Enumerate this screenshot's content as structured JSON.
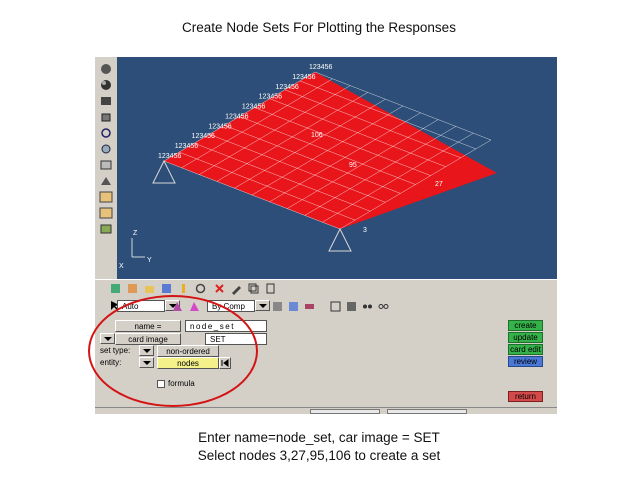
{
  "slide": {
    "title": "Create Node Sets For Plotting the Responses",
    "caption_line1": "Enter name=node_set, car image = SET",
    "caption_line2": "Select nodes 3,27,95,106 to create a set"
  },
  "viewport": {
    "background": "#2d4e78",
    "mesh_color": "#e8151b",
    "node_labels": [
      "123456",
      "123456",
      "123456",
      "123456",
      "123456",
      "123456",
      "123456",
      "123456",
      "123456",
      "123456"
    ],
    "node_ids": [
      "106",
      "95",
      "27",
      "3"
    ],
    "axes": {
      "z": "Z",
      "x": "X",
      "y": "Y"
    }
  },
  "optbar": {
    "auto_label": "Auto",
    "comp_label": "By Comp"
  },
  "panel": {
    "name_label": "name =",
    "name_value": "node_set",
    "card_image_label": "card image",
    "card_image_value": "SET",
    "set_type_label": "set type:",
    "set_type_value": "non-ordered",
    "entity_label": "entity:",
    "entity_value": "nodes",
    "formula_label": "formula",
    "buttons": {
      "create": "create",
      "update": "update",
      "card_edit": "card edit",
      "review": "review",
      "return": "return"
    }
  },
  "colors": {
    "accent_green": "#35b24a",
    "review_blue": "#4a78d6",
    "return_red": "#d44a4a",
    "highlight_yellow": "#f4f08a",
    "annotation_red": "#d41414"
  }
}
